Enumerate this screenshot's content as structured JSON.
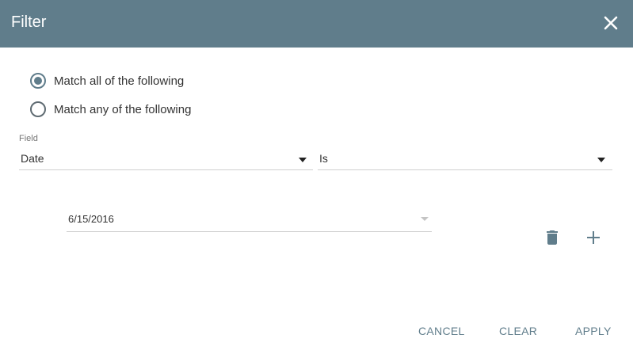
{
  "dialog": {
    "title": "Filter",
    "close_icon": "close-icon",
    "header_color": "#607d8b",
    "accent_color": "#607d8b"
  },
  "match_mode": {
    "options": [
      {
        "label": "Match all of the following",
        "checked": true
      },
      {
        "label": "Match any of the following",
        "checked": false
      }
    ]
  },
  "field": {
    "label": "Field",
    "value": "Date",
    "operator": "Is"
  },
  "condition": {
    "date_value": "6/15/2016",
    "delete_icon": "trash-icon",
    "add_icon": "plus-icon"
  },
  "footer": {
    "cancel_label": "CANCEL",
    "clear_label": "CLEAR",
    "apply_label": "APPLY"
  }
}
